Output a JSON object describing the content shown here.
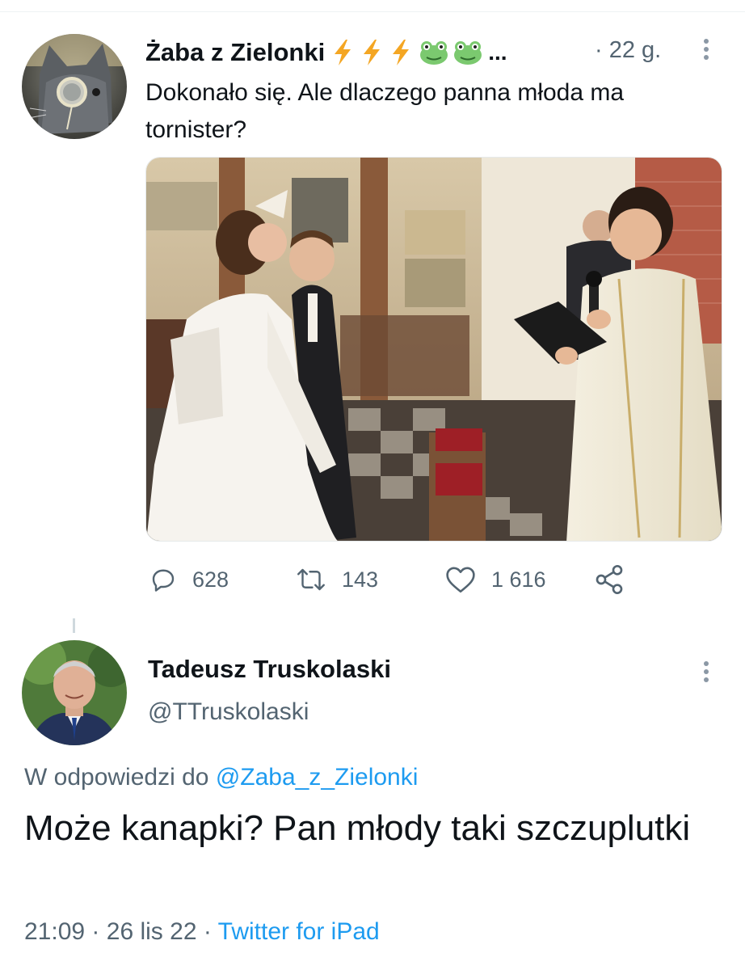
{
  "tweet": {
    "author_name": "Żaba z Zielonki",
    "author_emoji": [
      "lightning-icon",
      "lightning-icon",
      "lightning-icon",
      "frog-icon",
      "frog-icon"
    ],
    "truncation": "...",
    "time": "· 22 g.",
    "text": "Dokonało się. Ale dlaczego panna młoda ma tornister?",
    "stats": {
      "replies": "628",
      "retweets": "143",
      "likes": "1 616"
    }
  },
  "reply": {
    "author_name": "Tadeusz Truskolaski",
    "handle": "@TTruskolaski",
    "replying_prefix": "W odpowiedzi do",
    "replying_handle": "@Zaba_z_Zielonki",
    "text": "Może kanapki? Pan młody taki szczuplutki",
    "time": "21:09",
    "date": "26 lis 22",
    "separator": "·",
    "client": "Twitter for iPad"
  },
  "colors": {
    "link": "#1d9bf0",
    "secondary_text": "#536471",
    "primary_text": "#0f1419",
    "lightning": "#f4a623",
    "frog": "#7bc96f"
  }
}
